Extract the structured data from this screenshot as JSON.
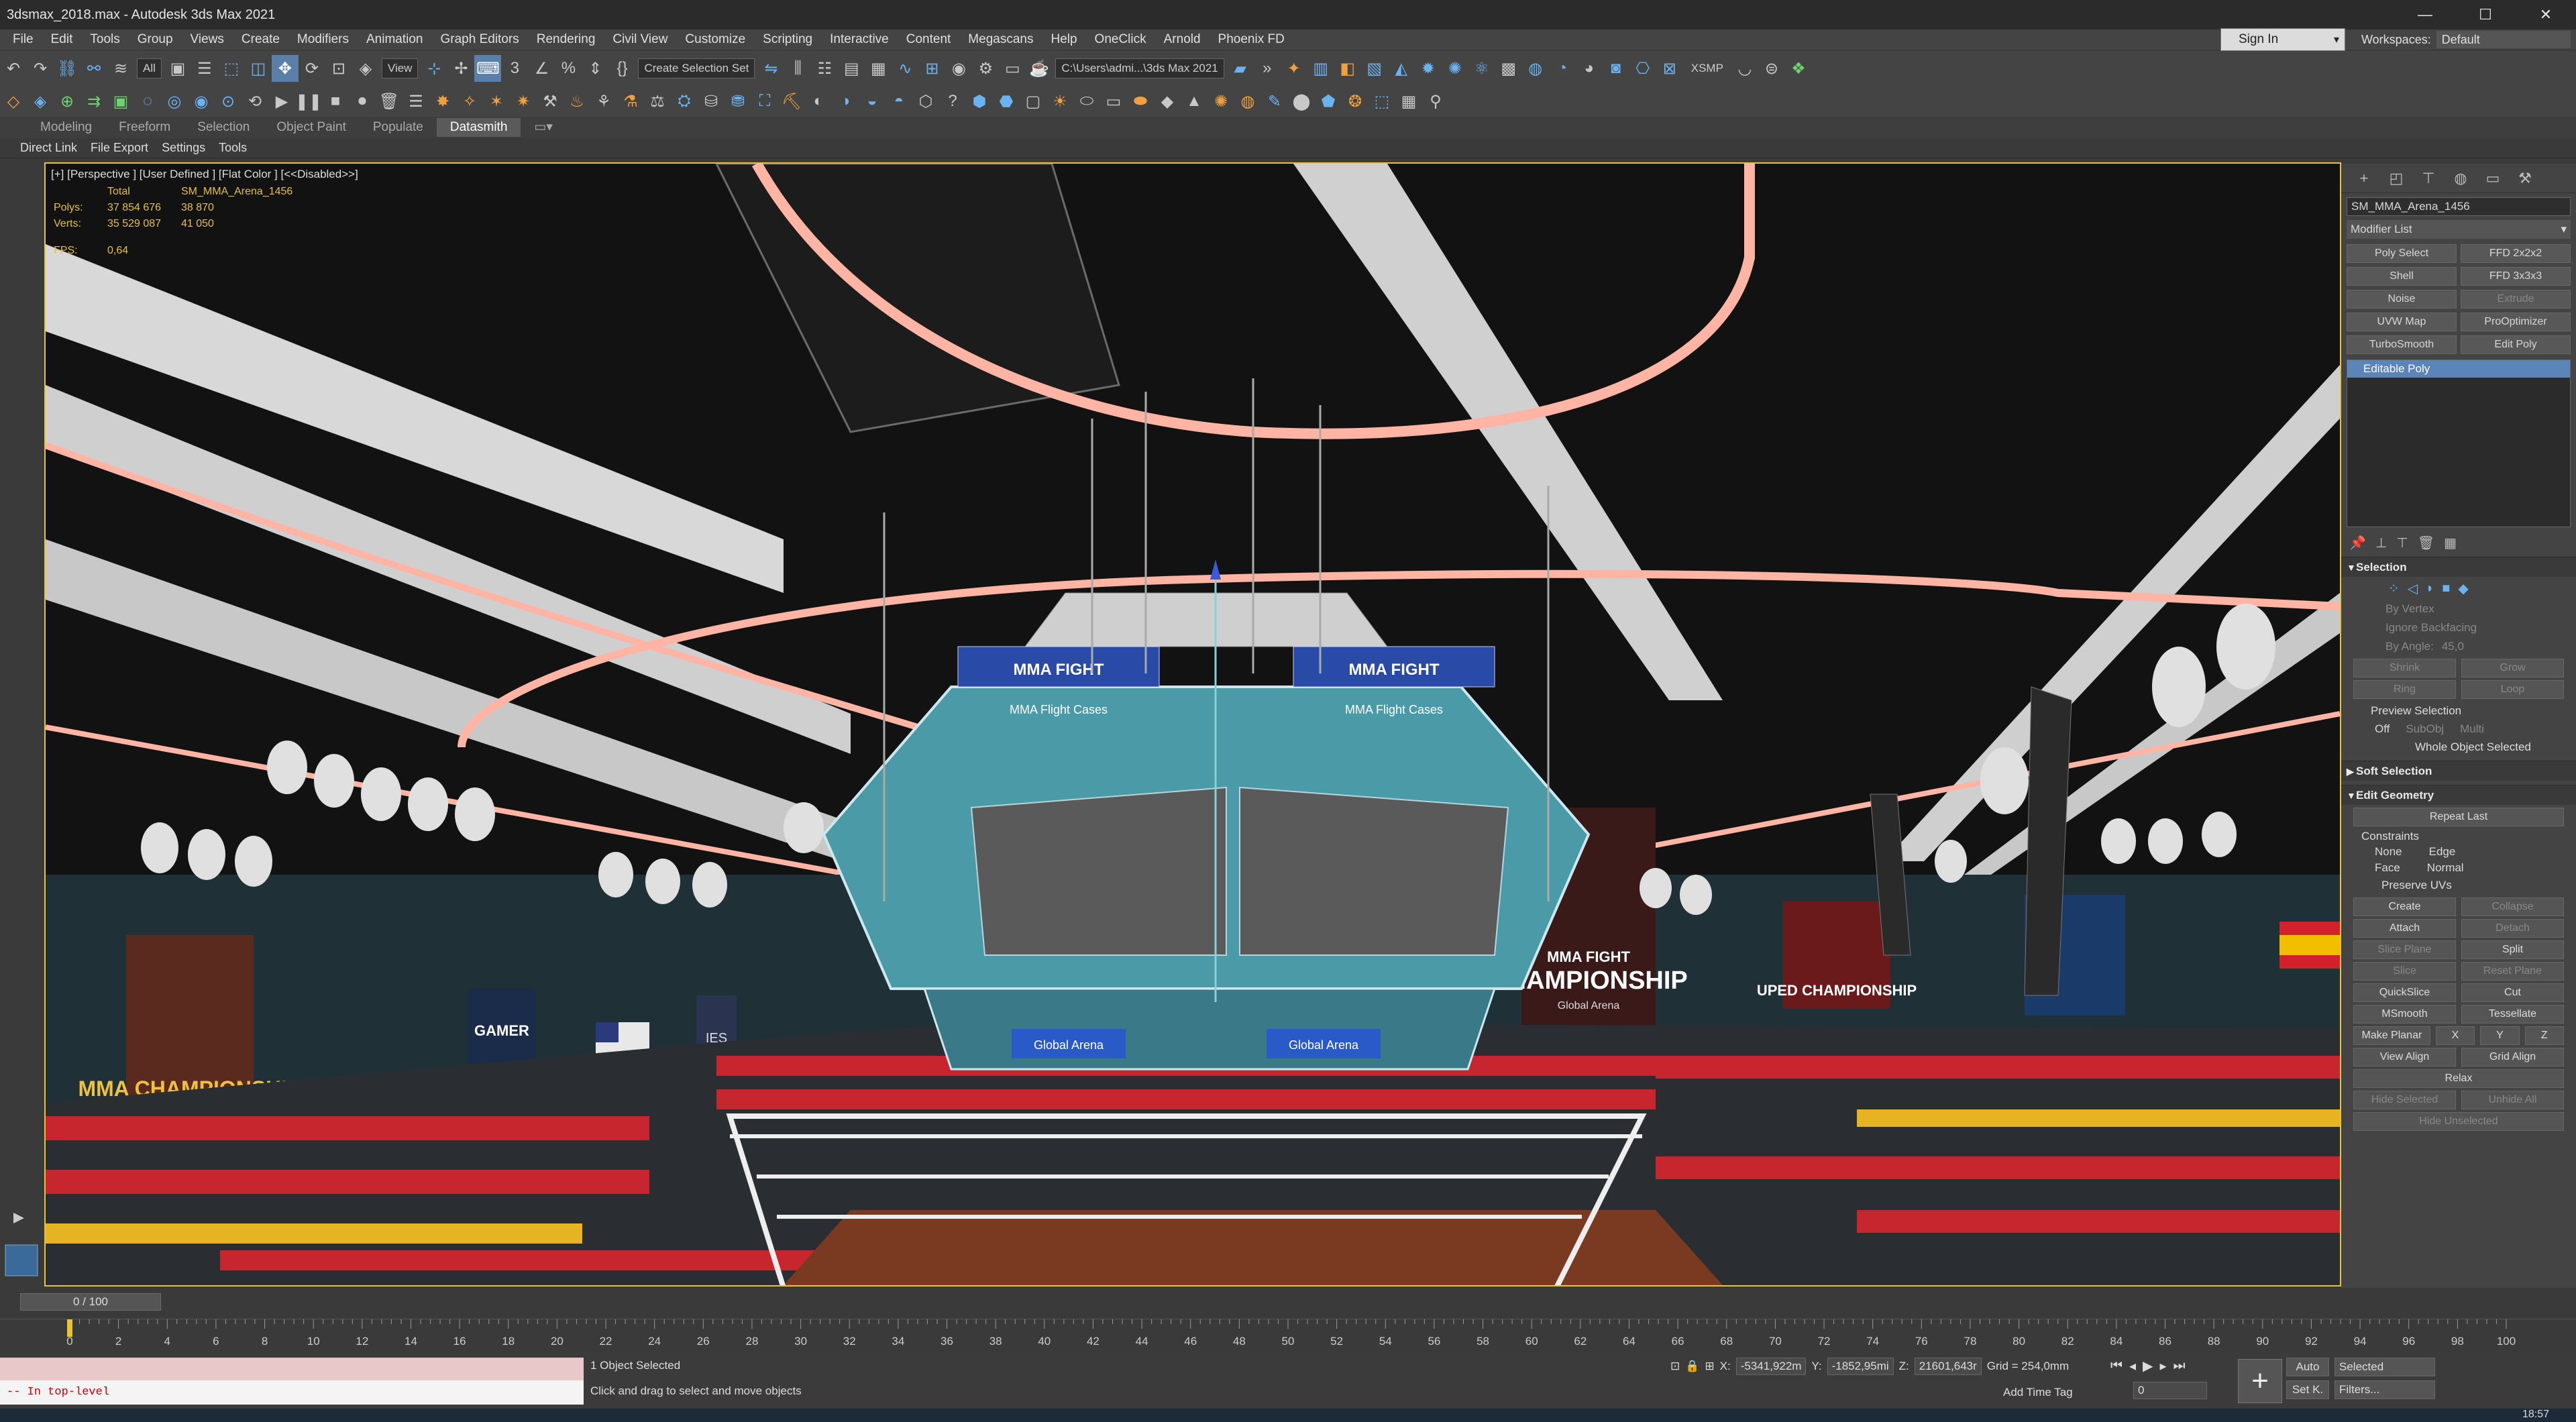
{
  "window": {
    "title": "3dsmax_2018.max - Autodesk 3ds Max 2021",
    "minimize": "—",
    "maximize": "☐",
    "close": "✕"
  },
  "menu": [
    "File",
    "Edit",
    "Tools",
    "Group",
    "Views",
    "Create",
    "Modifiers",
    "Animation",
    "Graph Editors",
    "Rendering",
    "Civil View",
    "Customize",
    "Scripting",
    "Interactive",
    "Content",
    "Megascans",
    "Help",
    "OneClick",
    "Arnold",
    "Phoenix FD"
  ],
  "signin": {
    "label": "Sign In"
  },
  "workspaces": {
    "label": "Workspaces:",
    "value": "Default"
  },
  "toolbar": {
    "filter": "All",
    "refcoord": "View",
    "selection_set": "Create Selection Set",
    "project_path": "C:\\Users\\admi...\\3ds Max 2021",
    "xsmp": "XSMP"
  },
  "ribbon": {
    "tabs": [
      "Modeling",
      "Freeform",
      "Selection",
      "Object Paint",
      "Populate",
      "Datasmith"
    ],
    "active_tab": "Datasmith",
    "subtabs": [
      "Direct Link",
      "File Export",
      "Settings",
      "Tools"
    ]
  },
  "viewport": {
    "label": "[+] [Perspective ] [User Defined ] [Flat Color ] [<<Disabled>>]",
    "stats": {
      "header_total": "Total",
      "header_object": "SM_MMA_Arena_1456",
      "polys_label": "Polys:",
      "polys_total": "37 854 676",
      "polys_object": "38 870",
      "verts_label": "Verts:",
      "verts_total": "35 529 087",
      "verts_object": "41 050",
      "fps_label": "FPS:",
      "fps_value": "0,64"
    },
    "signs": {
      "left_poster": "MMA CHAMPIONSHIP",
      "gamer_poster": "GAMER",
      "ies_poster": "IES",
      "center_poster_title": "MMA FIGHT",
      "center_poster_big": "CHAMPIONSHIP",
      "center_poster_sub": "Global Arena",
      "right_poster": "UPED CHAMPIONSHIP",
      "jumbotron_top": "MMA FIGHT",
      "jumbotron_mid": "MMA Flight Cases",
      "jumbotron_bottom": "Global Arena"
    },
    "colors": {
      "ceiling": "#121212",
      "truss": "#ffb4a4",
      "jumbotron": "#4a9aa8",
      "seat_red": "#c8262e",
      "seat_yellow": "#e6b422",
      "seat_dark": "#2a2e33",
      "selection": "#e8c33a"
    }
  },
  "command_panel": {
    "object_name": "SM_MMA_Arena_1456",
    "modifier_list": "Modifier List",
    "modifier_buttons": [
      "Poly Select",
      "FFD 2x2x2",
      "Shell",
      "FFD 3x3x3",
      "Noise",
      "Extrude",
      "UVW Map",
      "ProOptimizer",
      "TurboSmooth",
      "Edit Poly"
    ],
    "stack_item": "Editable Poly",
    "selection": {
      "title": "Selection",
      "by_vertex": "By Vertex",
      "ignore_backfacing": "Ignore Backfacing",
      "by_angle": "By Angle:",
      "angle_value": "45,0",
      "shrink": "Shrink",
      "grow": "Grow",
      "ring": "Ring",
      "loop": "Loop",
      "preview": "Preview Selection",
      "off": "Off",
      "subobj": "SubObj",
      "multi": "Multi",
      "whole": "Whole Object Selected"
    },
    "soft_selection": "Soft Selection",
    "edit_geometry": {
      "title": "Edit Geometry",
      "repeat_last": "Repeat Last",
      "constraints": "Constraints",
      "none": "None",
      "edge": "Edge",
      "face": "Face",
      "normal": "Normal",
      "preserve_uvs": "Preserve UVs",
      "create": "Create",
      "collapse": "Collapse",
      "attach": "Attach",
      "detach": "Detach",
      "slice_plane": "Slice Plane",
      "split": "Split",
      "slice": "Slice",
      "reset_plane": "Reset Plane",
      "quickslice": "QuickSlice",
      "cut": "Cut",
      "msmooth": "MSmooth",
      "tessellate": "Tessellate",
      "make_planar": "Make Planar",
      "x": "X",
      "y": "Y",
      "z": "Z",
      "view_align": "View Align",
      "grid_align": "Grid Align",
      "relax": "Relax",
      "hide_selected": "Hide Selected",
      "unhide_all": "Unhide All",
      "hide_unselected": "Hide Unselected"
    }
  },
  "timeline": {
    "frame_display": "0 / 100",
    "ticks": [
      "0",
      "2",
      "4",
      "6",
      "8",
      "10",
      "12",
      "14",
      "16",
      "18",
      "20",
      "22",
      "24",
      "26",
      "28",
      "30",
      "32",
      "34",
      "36",
      "38",
      "40",
      "42",
      "44",
      "46",
      "48",
      "50",
      "52",
      "54",
      "56",
      "58",
      "60",
      "62",
      "64",
      "66",
      "68",
      "70",
      "72",
      "74",
      "76",
      "78",
      "80",
      "82",
      "84",
      "86",
      "88",
      "90",
      "92",
      "94",
      "96",
      "98",
      "100"
    ]
  },
  "status": {
    "maxscript_output": "-- In top-level",
    "selection_info": "1 Object Selected",
    "prompt": "Click and drag to select and move objects",
    "x_label": "X:",
    "x_value": "-5341,922m",
    "y_label": "Y:",
    "y_value": "-1852,95mi",
    "z_label": "Z:",
    "z_value": "21601,643r",
    "grid": "Grid = 254,0mm",
    "add_time_tag": "Add Time Tag",
    "auto": "Auto",
    "set_k": "Set K.",
    "selected": "Selected",
    "filters": "Filters...",
    "frame_value": "0",
    "clock": "18:57"
  }
}
